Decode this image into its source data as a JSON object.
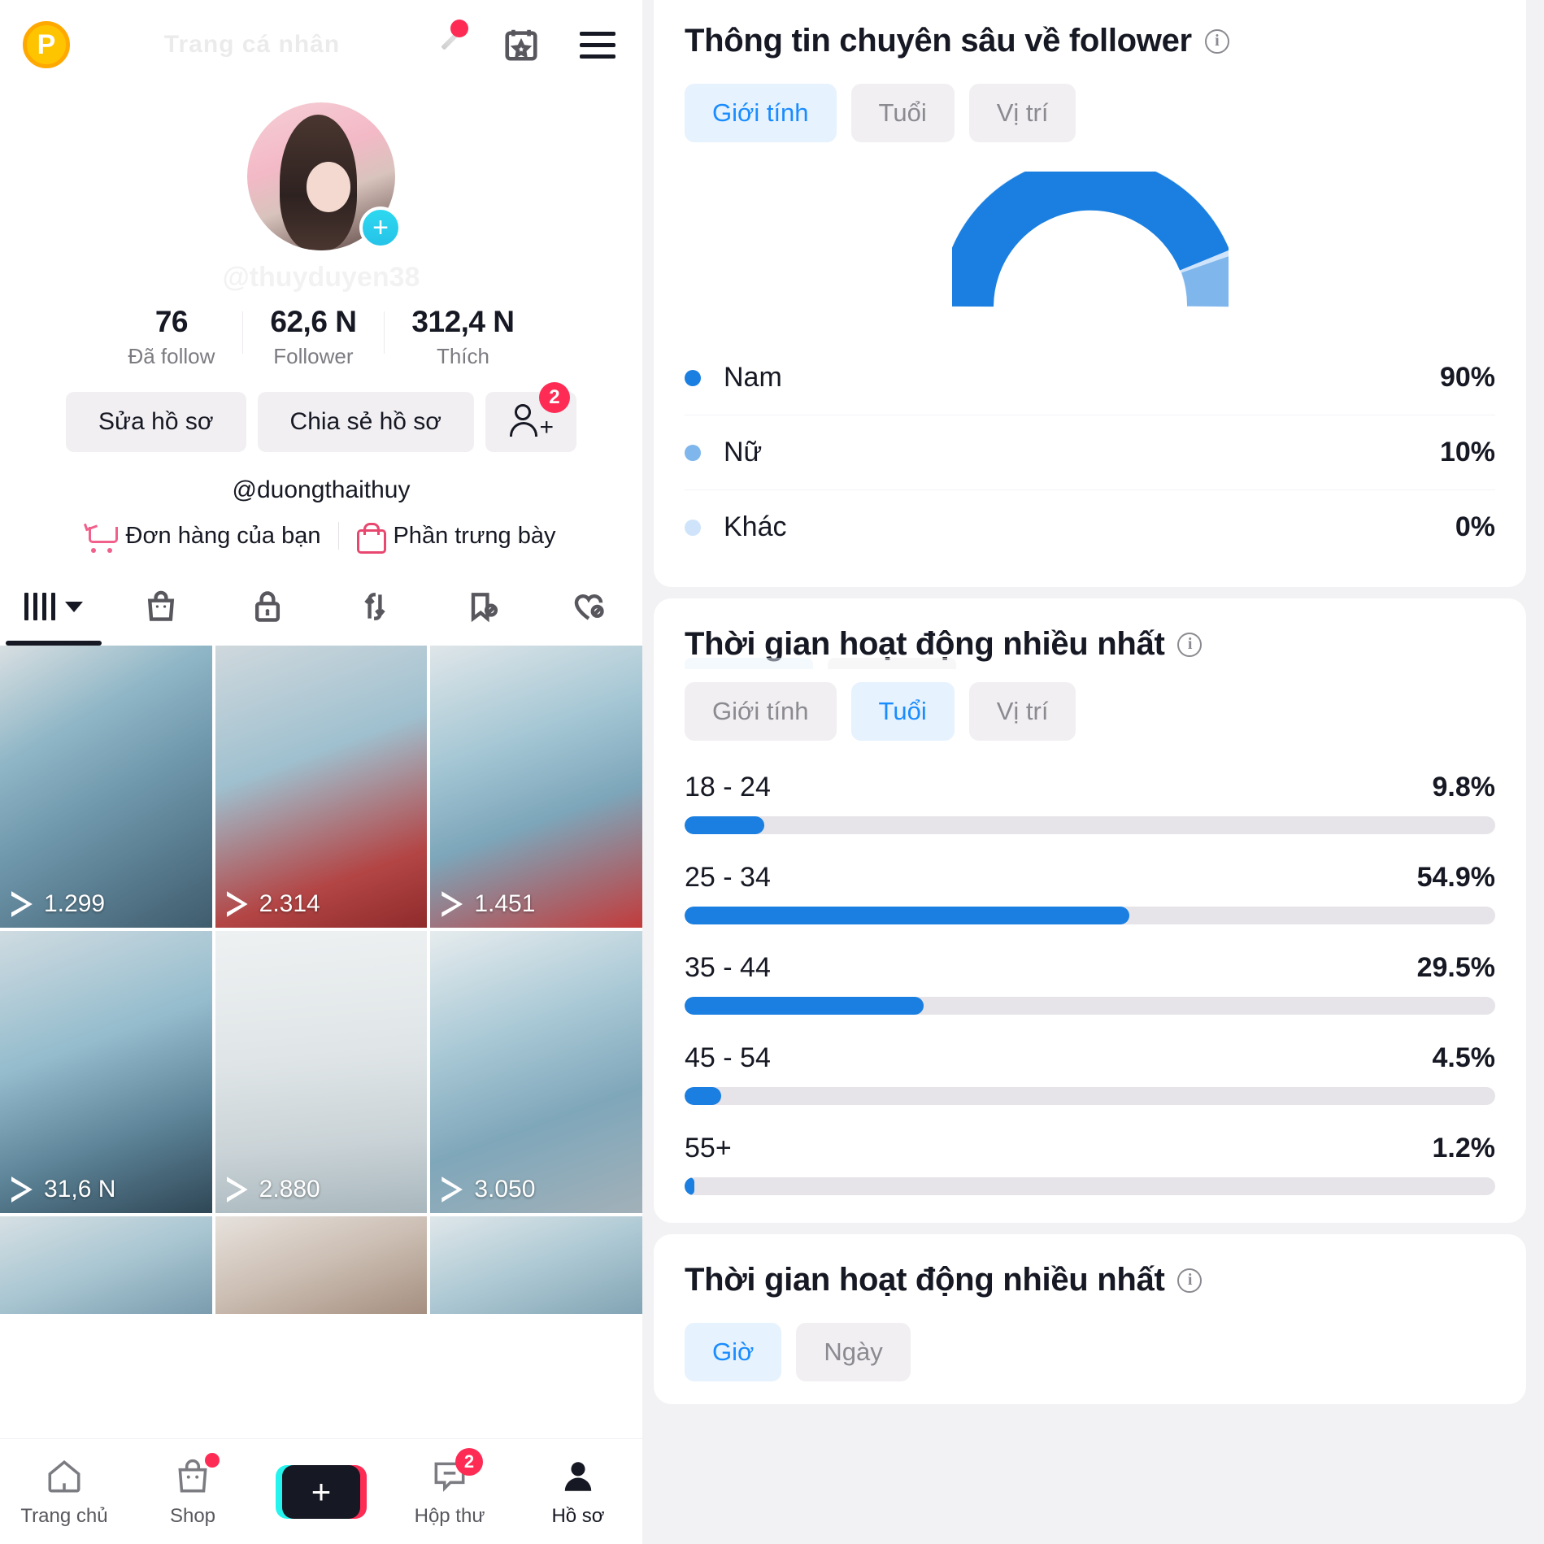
{
  "profile": {
    "topbar": {
      "coin_label": "P",
      "ghost_title": "Trang cá nhân",
      "pencil_icon": "pencil-icon",
      "calendar_icon": "calendar-star-icon",
      "menu_icon": "hamburger-menu-icon"
    },
    "avatar": {
      "add_label": "+",
      "ghost_handle": "@thuyduyen38"
    },
    "stats": [
      {
        "value": "76",
        "label": "Đã follow"
      },
      {
        "value": "62,6 N",
        "label": "Follower"
      },
      {
        "value": "312,4 N",
        "label": "Thích"
      }
    ],
    "actions": {
      "edit_profile": "Sửa hồ sơ",
      "share_profile": "Chia sẻ hồ sơ",
      "add_friend_badge": "2"
    },
    "handle": "@duongthaithuy",
    "shop_links": [
      {
        "label": "Đơn hàng của bạn",
        "icon": "cart-icon"
      },
      {
        "label": "Phần trưng bày",
        "icon": "shopping-bag-icon"
      }
    ],
    "tabs": [
      {
        "name": "grid-tab",
        "icon": "grid-icon",
        "active": true
      },
      {
        "name": "shop-tab",
        "icon": "shopping-bag-icon",
        "active": false
      },
      {
        "name": "private-tab",
        "icon": "lock-icon",
        "active": false
      },
      {
        "name": "repost-tab",
        "icon": "repost-icon",
        "active": false
      },
      {
        "name": "hidden-bookmark-tab",
        "icon": "bookmark-off-icon",
        "active": false
      },
      {
        "name": "hidden-liked-tab",
        "icon": "heart-off-icon",
        "active": false
      }
    ],
    "videos": [
      {
        "views": "1.299"
      },
      {
        "views": "2.314"
      },
      {
        "views": "1.451"
      },
      {
        "views": "31,6 N"
      },
      {
        "views": "2.880"
      },
      {
        "views": "3.050"
      }
    ],
    "bottom_nav": [
      {
        "label": "Trang chủ",
        "icon": "home-icon",
        "badge": "",
        "dot": false,
        "active": false
      },
      {
        "label": "Shop",
        "icon": "shopping-bag-icon",
        "badge": "",
        "dot": true,
        "active": false
      },
      {
        "label": "",
        "icon": "create-plus-icon",
        "badge": "",
        "dot": false,
        "active": false
      },
      {
        "label": "Hộp thư",
        "icon": "inbox-icon",
        "badge": "2",
        "dot": false,
        "active": false
      },
      {
        "label": "Hồ sơ",
        "icon": "person-icon",
        "badge": "",
        "dot": false,
        "active": true
      }
    ],
    "create_label": "+"
  },
  "analytics": {
    "follower_insights": {
      "title": "Thông tin chuyên sâu về follower",
      "info_icon": "info-icon",
      "chips": [
        {
          "label": "Giới tính",
          "active": true
        },
        {
          "label": "Tuổi",
          "active": false
        },
        {
          "label": "Vị trí",
          "active": false
        }
      ]
    },
    "active_time_age": {
      "title": "Thời gian hoạt động nhiều nhất",
      "info_icon": "info-icon",
      "chips": [
        {
          "label": "Giới tính",
          "active": false
        },
        {
          "label": "Tuổi",
          "active": true
        },
        {
          "label": "Vị trí",
          "active": false
        }
      ]
    },
    "active_time_hours": {
      "title": "Thời gian hoạt động nhiều nhất",
      "info_icon": "info-icon",
      "chips": [
        {
          "label": "Giờ",
          "active": true
        },
        {
          "label": "Ngày",
          "active": false
        }
      ]
    },
    "colors": {
      "primary_blue": "#1a7fe0",
      "light_blue": "#7fb6ec",
      "pale_blue": "#cfe4fa",
      "accent_pink": "#FE2C55",
      "chip_active_bg": "#e6f2fd",
      "chip_active_text": "#1a8cff",
      "track_gray": "#e6e4e8"
    }
  },
  "chart_data": [
    {
      "type": "pie",
      "title": "Giới tính follower",
      "subtitle": "",
      "display": "semi-donut gauge",
      "categories": [
        "Nam",
        "Nữ",
        "Khác"
      ],
      "values": [
        90,
        10,
        0
      ],
      "labels": [
        "90%",
        "10%",
        "0%"
      ],
      "colors": [
        "#1a7fe0",
        "#7fb6ec",
        "#cfe4fa"
      ],
      "legend_position": "below",
      "unit": "%"
    },
    {
      "type": "bar",
      "orientation": "horizontal",
      "title": "Thời gian hoạt động nhiều nhất — Tuổi",
      "categories": [
        "18 - 24",
        "25 - 34",
        "35 - 44",
        "45 - 54",
        "55+"
      ],
      "values": [
        9.8,
        54.9,
        29.5,
        4.5,
        1.2
      ],
      "labels": [
        "9.8%",
        "54.9%",
        "29.5%",
        "4.5%",
        "1.2%"
      ],
      "xlabel": "",
      "ylabel": "",
      "xlim": [
        0,
        100
      ],
      "grid": false,
      "bar_color": "#1a7fe0",
      "track_color": "#e6e4e8",
      "unit": "%"
    }
  ]
}
